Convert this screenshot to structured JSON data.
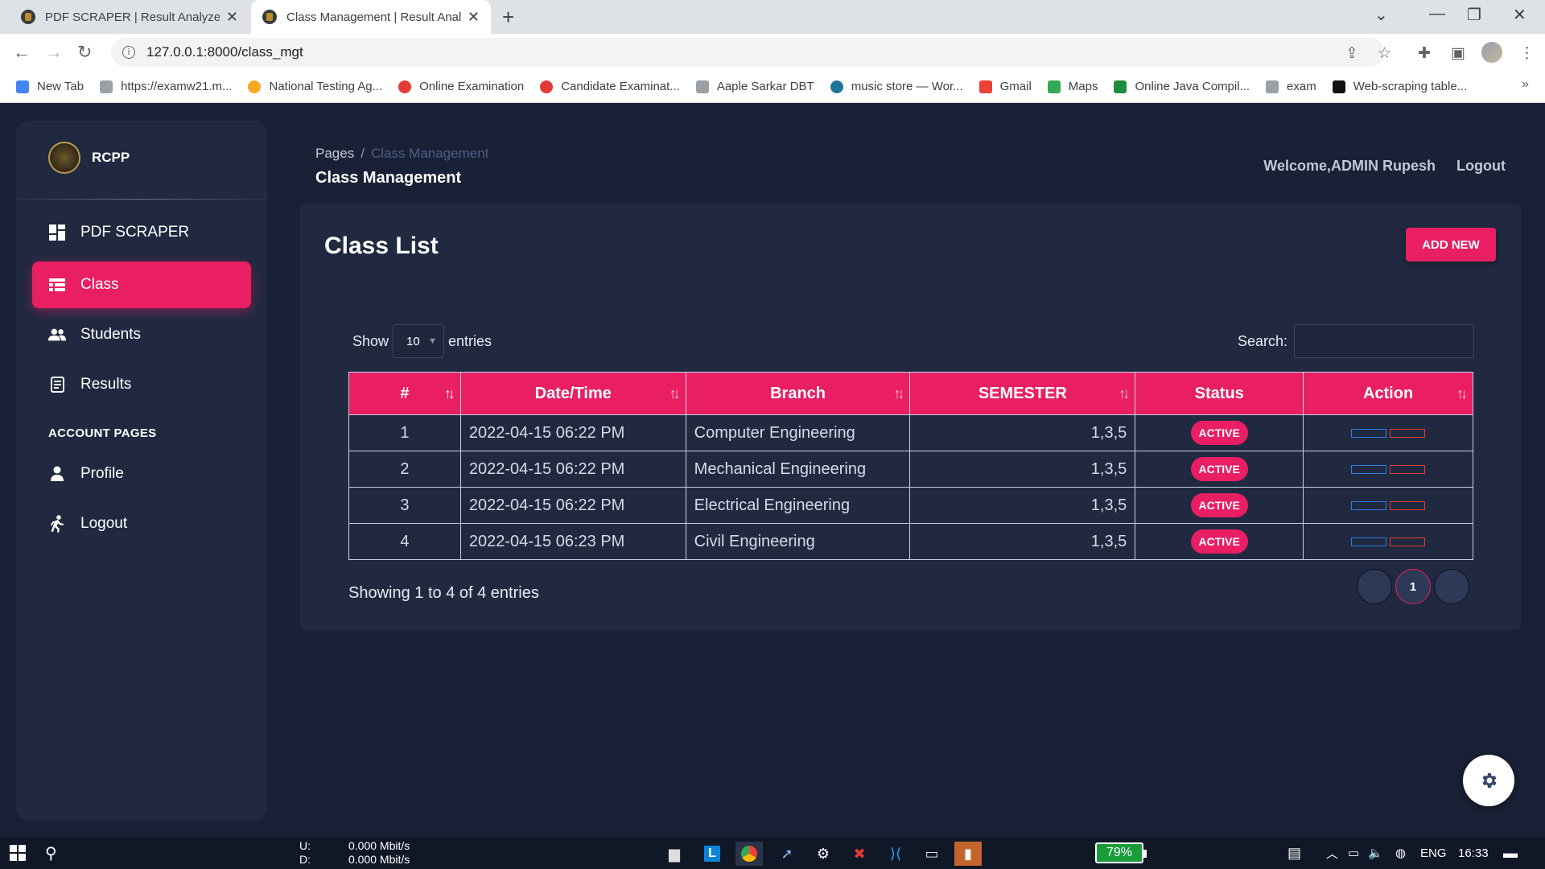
{
  "browser": {
    "tabs": [
      {
        "title": "PDF SCRAPER | Result Analyzer Sy"
      },
      {
        "title": "Class Management | Result Analy"
      }
    ],
    "url": "127.0.0.1:8000/class_mgt",
    "bookmarks": [
      {
        "label": "New Tab",
        "color": "#4285f4"
      },
      {
        "label": "https://examw21.m...",
        "color": "#9aa0a6"
      },
      {
        "label": "National Testing Ag...",
        "color": "#f9a825"
      },
      {
        "label": "Online Examination",
        "color": "#e53935"
      },
      {
        "label": "Candidate Examinat...",
        "color": "#e53935"
      },
      {
        "label": "Aaple Sarkar DBT",
        "color": "#9aa0a6"
      },
      {
        "label": "music store — Wor...",
        "color": "#21759b"
      },
      {
        "label": "Gmail",
        "color": "#ea4335"
      },
      {
        "label": "Maps",
        "color": "#34a853"
      },
      {
        "label": "Online Java Compil...",
        "color": "#1e8e3e"
      },
      {
        "label": "exam",
        "color": "#9aa0a6"
      },
      {
        "label": "Web-scraping table...",
        "color": "#111111"
      }
    ]
  },
  "sidebar": {
    "brand": "RCPP",
    "items": [
      {
        "label": "PDF SCRAPER",
        "icon": "dashboard-icon"
      },
      {
        "label": "Class",
        "icon": "table-icon",
        "active": true
      },
      {
        "label": "Students",
        "icon": "users-icon"
      },
      {
        "label": "Results",
        "icon": "receipt-icon"
      }
    ],
    "section_label": "ACCOUNT PAGES",
    "account_items": [
      {
        "label": "Profile",
        "icon": "person-icon"
      },
      {
        "label": "Logout",
        "icon": "running-icon"
      }
    ]
  },
  "header": {
    "breadcrumb_root": "Pages",
    "breadcrumb_sep": "/",
    "breadcrumb_current": "Class Management",
    "title": "Class Management",
    "welcome": "Welcome,ADMIN Rupesh",
    "logout": "Logout"
  },
  "card": {
    "title": "Class List",
    "add_button": "ADD NEW",
    "show_label": "Show",
    "entries_value": "10",
    "entries_label": "entries",
    "search_label": "Search:",
    "columns": [
      "#",
      "Date/Time",
      "Branch",
      "SEMESTER",
      "Status",
      "Action"
    ],
    "rows": [
      {
        "num": "1",
        "datetime": "2022-04-15 06:22 PM",
        "branch": "Computer Engineering",
        "semester": "1,3,5",
        "status": "ACTIVE"
      },
      {
        "num": "2",
        "datetime": "2022-04-15 06:22 PM",
        "branch": "Mechanical Engineering",
        "semester": "1,3,5",
        "status": "ACTIVE"
      },
      {
        "num": "3",
        "datetime": "2022-04-15 06:22 PM",
        "branch": "Electrical Engineering",
        "semester": "1,3,5",
        "status": "ACTIVE"
      },
      {
        "num": "4",
        "datetime": "2022-04-15 06:23 PM",
        "branch": "Civil Engineering",
        "semester": "1,3,5",
        "status": "ACTIVE"
      }
    ],
    "info": "Showing 1 to 4 of 4 entries",
    "page_current": "1"
  },
  "taskbar": {
    "upload_label": "U:",
    "download_label": "D:",
    "upload_rate": "0.000 Mbit/s",
    "download_rate": "0.000 Mbit/s",
    "battery": "79%",
    "language": "ENG",
    "time": "16:33"
  },
  "colors": {
    "accent": "#e91e63",
    "background": "#1a2035",
    "panel": "#202940"
  }
}
